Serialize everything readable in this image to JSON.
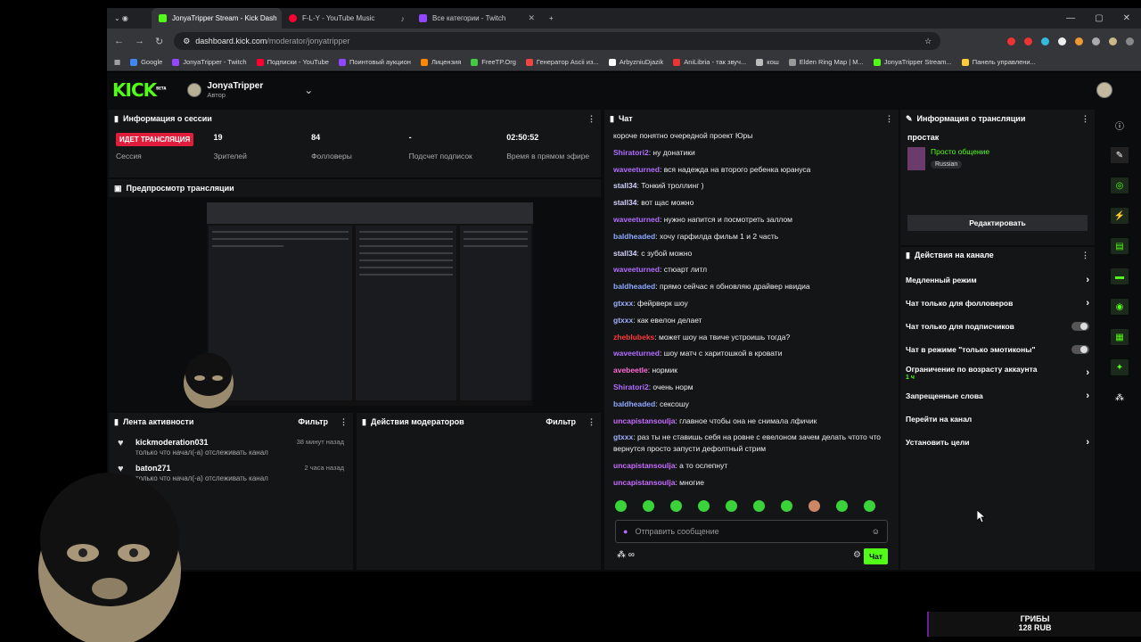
{
  "browser": {
    "tabs": [
      {
        "title": "JonyaTripper Stream - Kick Dash",
        "color": "#53fc18",
        "active": true
      },
      {
        "title": "F-L-Y - YouTube Music",
        "color": "#ff0033",
        "active": false
      },
      {
        "title": "Все категории - Twitch",
        "color": "#9146ff",
        "active": false
      }
    ],
    "url_host": "dashboard.kick.com",
    "url_path": "/moderator/jonyatripper",
    "bookmarks": [
      "Google",
      "JonyaTripper - Twitch",
      "Подписки - YouTube",
      "Поинтовый аукцион",
      "Лицензия",
      "FreeTP.Org",
      "Генератор Ascii из...",
      "ArbyzniuDjazik",
      "AniLibria - так звуч...",
      "кош",
      "Elden Ring Map | M...",
      "JonyaTripper Stream...",
      "Панель управлени..."
    ]
  },
  "header": {
    "logo": "KICK",
    "logo_badge": "BETA",
    "username": "JonyaTripper",
    "role": "Автор"
  },
  "session": {
    "title": "Информация о сессии",
    "live_badge": "ИДЕТ ТРАНСЛЯЦИЯ",
    "session_label": "Сессия",
    "viewers": "19",
    "viewers_label": "Зрителей",
    "followers": "84",
    "followers_label": "Фолловеры",
    "subs": "-",
    "subs_label": "Подсчет подписок",
    "time": "02:50:52",
    "time_label": "Время в прямом эфире"
  },
  "preview": {
    "title": "Предпросмотр трансляции"
  },
  "activity": {
    "title": "Лента активности",
    "filter": "Фильтр",
    "items": [
      {
        "name": "kickmoderation031",
        "text": "только что начал(-а) отслеживать канал",
        "time": "38 минут назад"
      },
      {
        "name": "baton271",
        "text": "только что начал(-а) отслеживать канал",
        "time": "2 часа назад"
      }
    ]
  },
  "modactions": {
    "title": "Действия модераторов",
    "filter": "Фильтр"
  },
  "chat": {
    "title": "Чат",
    "messages": [
      {
        "user": "",
        "color": "#ffffff",
        "text": "короче понятно очередной проект Юры"
      },
      {
        "user": "Shiratori2",
        "color": "#b36cff",
        "text": "ну донатики"
      },
      {
        "user": "waveeturned",
        "color": "#b36cff",
        "text": "вся надежда на второго ребенка юрануса"
      },
      {
        "user": "stall34",
        "color": "#d0d0ff",
        "text": "Тонкий троллинг )"
      },
      {
        "user": "stall34",
        "color": "#d0d0ff",
        "text": "вот щас можно"
      },
      {
        "user": "waveeturned",
        "color": "#b36cff",
        "text": "нужно напится и посмотреть заллом"
      },
      {
        "user": "baldheaded",
        "color": "#8fa8ff",
        "text": "хочу гарфилда фильм 1 и 2 часть"
      },
      {
        "user": "stall34",
        "color": "#d0d0ff",
        "text": "с зубой можно"
      },
      {
        "user": "waveeturned",
        "color": "#b36cff",
        "text": "стюарт литл"
      },
      {
        "user": "baldheaded",
        "color": "#8fa8ff",
        "text": "прямо сейчас я обновляю драйвер нвидиа"
      },
      {
        "user": "gtxxx",
        "color": "#9fb0ff",
        "text": "фейрверк шоу"
      },
      {
        "user": "gtxxx",
        "color": "#9fb0ff",
        "text": "как евелон делает"
      },
      {
        "user": "zheblubeks",
        "color": "#ff3a3a",
        "text": "может шоу на твиче устроишь тогда?"
      },
      {
        "user": "waveeturned",
        "color": "#b36cff",
        "text": "шоу матч с харитошкой в кровати"
      },
      {
        "user": "avebeetle",
        "color": "#ff6ad5",
        "text": "нормик"
      },
      {
        "user": "Shiratori2",
        "color": "#b36cff",
        "text": "очень норм"
      },
      {
        "user": "baldheaded",
        "color": "#8fa8ff",
        "text": "сексошу"
      },
      {
        "user": "uncapistansoulja",
        "color": "#c86cff",
        "text": "главное чтобы она не снимала лфичик"
      },
      {
        "user": "gtxxx",
        "color": "#9fb0ff",
        "text": "раз ты не ставишь себя на ровне с евелоном зачем делать чтото что вернутся просто запусти дефолтный стрим"
      },
      {
        "user": "uncapistansoulja",
        "color": "#c86cff",
        "text": "а то ослепнут"
      },
      {
        "user": "uncapistansoulja",
        "color": "#c86cff",
        "text": "многие"
      }
    ],
    "placeholder": "Отправить сообщение",
    "send": "Чат",
    "infinity": "∞"
  },
  "stream_info": {
    "title": "Информация о трансляции",
    "stream_title": "простак",
    "category": "Просто общение",
    "language": "Russian",
    "edit": "Редактировать"
  },
  "channel_actions": {
    "title": "Действия на канале",
    "options": [
      {
        "label": "Медленный режим",
        "kind": "arrow",
        "sub": ""
      },
      {
        "label": "Чат только для фолловеров",
        "kind": "arrow",
        "sub": ""
      },
      {
        "label": "Чат только для подписчиков",
        "kind": "toggle",
        "sub": ""
      },
      {
        "label": "Чат в режиме \"только эмотиконы\"",
        "kind": "toggle",
        "sub": ""
      },
      {
        "label": "Ограничение по возрасту аккаунта",
        "kind": "arrow",
        "sub": "1 ч"
      },
      {
        "label": "Запрещенные слова",
        "kind": "arrow",
        "sub": ""
      },
      {
        "label": "Перейти на канал",
        "kind": "none",
        "sub": ""
      },
      {
        "label": "Установить цели",
        "kind": "arrow",
        "sub": ""
      }
    ]
  },
  "donation": {
    "line1": "ГРИБЫ",
    "line2": "128 RUB"
  }
}
